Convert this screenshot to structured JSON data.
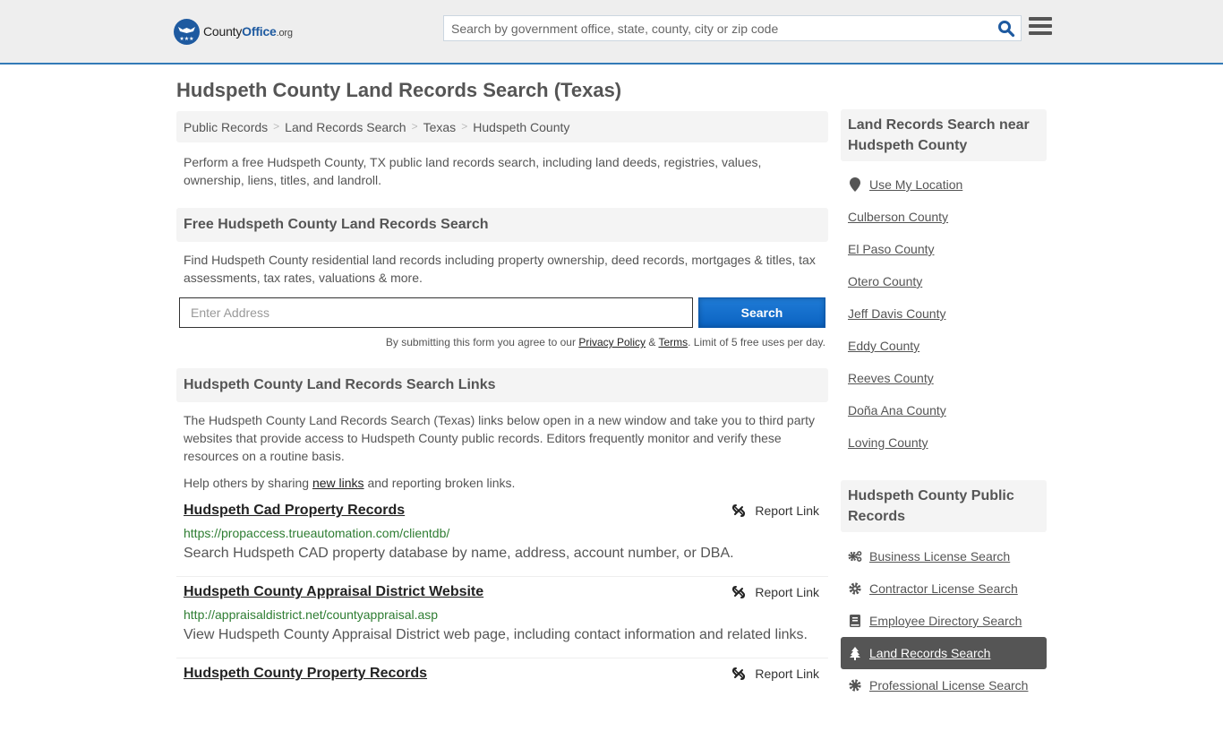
{
  "header": {
    "logo": {
      "name": "County",
      "name_bold": "Office",
      "tld": ".org"
    },
    "search": {
      "placeholder": "Search by government office, state, county, city or zip code",
      "value": ""
    },
    "colors": {
      "accent": "#337ab7",
      "brand": "#1e5aa0"
    }
  },
  "page": {
    "title": "Hudspeth County Land Records Search (Texas)",
    "breadcrumb": [
      "Public Records",
      "Land Records Search",
      "Texas",
      "Hudspeth County"
    ],
    "intro": "Perform a free Hudspeth County, TX public land records search, including land deeds, registries, values, ownership, liens, titles, and landroll."
  },
  "free_search": {
    "heading": "Free Hudspeth County Land Records Search",
    "description": "Find Hudspeth County residential land records including property ownership, deed records, mortgages & titles, tax assessments, tax rates, valuations & more.",
    "address_placeholder": "Enter Address",
    "address_value": "",
    "button_label": "Search",
    "disclaimer_prefix": "By submitting this form you agree to our ",
    "privacy_label": "Privacy Policy",
    "amp": " & ",
    "terms_label": "Terms",
    "disclaimer_suffix": ". Limit of 5 free uses per day.",
    "button_color": "#1270cf"
  },
  "links_section": {
    "heading": "Hudspeth County Land Records Search Links",
    "description": "The Hudspeth County Land Records Search (Texas) links below open in a new window and take you to third party websites that provide access to Hudspeth County public records. Editors frequently monitor and verify these resources on a routine basis.",
    "help_prefix": "Help others by sharing ",
    "help_link": "new links",
    "help_suffix": " and reporting broken links.",
    "report_label": "Report Link",
    "items": [
      {
        "title": "Hudspeth Cad Property Records",
        "url": "https://propaccess.trueautomation.com/clientdb/",
        "description": "Search Hudspeth CAD property database by name, address, account number, or DBA."
      },
      {
        "title": "Hudspeth County Appraisal District Website",
        "url": "http://appraisaldistrict.net/countyappraisal.asp",
        "description": "View Hudspeth County Appraisal District web page, including contact information and related links."
      },
      {
        "title": "Hudspeth County Property Records",
        "url": "",
        "description": ""
      }
    ]
  },
  "sidebar": {
    "nearby": {
      "heading": "Land Records Search near Hudspeth County",
      "use_location": "Use My Location",
      "items": [
        "Culberson County",
        "El Paso County",
        "Otero County",
        "Jeff Davis County",
        "Eddy County",
        "Reeves County",
        "Doña Ana County",
        "Loving County"
      ]
    },
    "public_records": {
      "heading": "Hudspeth County Public Records",
      "items": [
        {
          "label": "Business License Search",
          "icon": "gears-icon",
          "active": false
        },
        {
          "label": "Contractor License Search",
          "icon": "gear-icon",
          "active": false
        },
        {
          "label": "Employee Directory Search",
          "icon": "book-icon",
          "active": false
        },
        {
          "label": "Land Records Search",
          "icon": "tree-icon",
          "active": true
        },
        {
          "label": "Professional License Search",
          "icon": "gear-icon",
          "active": false
        }
      ]
    }
  }
}
